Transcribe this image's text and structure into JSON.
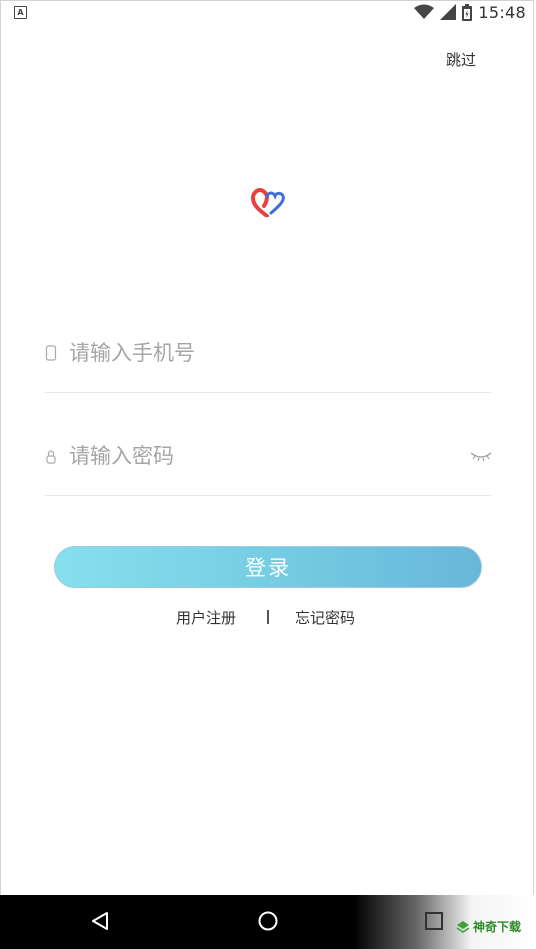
{
  "status_bar": {
    "notification_glyph": "A",
    "time": "15:48",
    "icons": [
      "wifi-icon",
      "signal-icon",
      "battery-icon"
    ]
  },
  "header": {
    "skip_label": "跳过"
  },
  "login_form": {
    "phone_placeholder": "请输入手机号",
    "password_placeholder": "请输入密码",
    "login_label": "登录"
  },
  "links": {
    "register_label": "用户注册",
    "forgot_label": "忘记密码"
  },
  "nav_bar": {
    "icons": [
      "back-icon",
      "home-icon",
      "recents-icon"
    ]
  },
  "watermark": {
    "text": "神奇下载"
  },
  "colors": {
    "button_start": "#86e0ec",
    "button_end": "#69b6da",
    "logo_red": "#e8403f",
    "logo_blue": "#3f6fd6",
    "placeholder": "#a5a5a5",
    "text": "#333333"
  }
}
